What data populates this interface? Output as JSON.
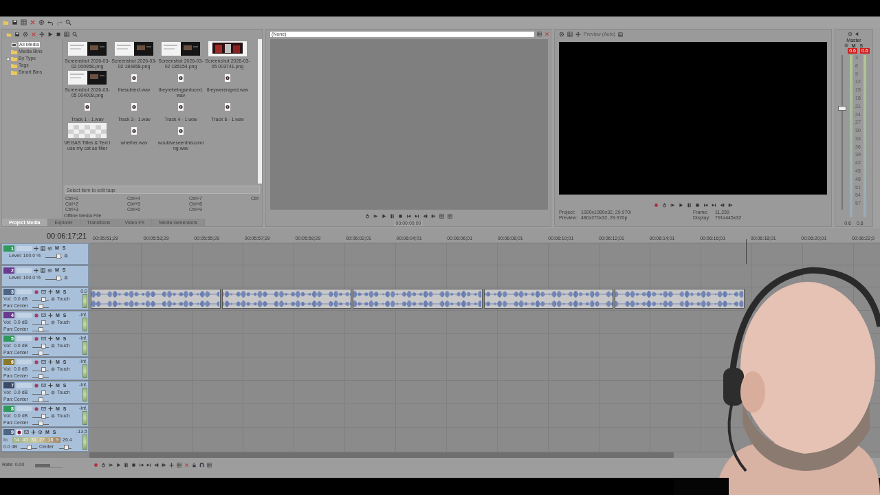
{
  "explorer": {
    "tree": [
      {
        "label": "All Media",
        "kind": "all",
        "selected": true
      },
      {
        "label": "Media Bins",
        "kind": "folder",
        "selected": false
      },
      {
        "label": "By Type",
        "kind": "collapsed_folder",
        "selected": false
      },
      {
        "label": "Tags",
        "kind": "folder",
        "selected": false
      },
      {
        "label": "Smart Bins",
        "kind": "folder",
        "selected": false
      }
    ],
    "media": [
      {
        "name": "Screenshot 2026-03-02 000958.png"
      },
      {
        "name": "Screenshot 2026-03-02 184858.png"
      },
      {
        "name": "Screenshot 2026-03-02 185154.png"
      },
      {
        "name": "Screenshot 2026-03-05 003741.png"
      },
      {
        "name": "Screenshot 2026-03-05 004008.png"
      },
      {
        "name": "thesubtext.wav",
        "kind": "audio"
      },
      {
        "name": "theyrebeingseduced.wav",
        "kind": "audio"
      },
      {
        "name": "theywereraped.wav",
        "kind": "audio"
      },
      {
        "name": "Track 1 - 1.wav",
        "kind": "audio"
      },
      {
        "name": "Track 3 - 1.wav",
        "kind": "audio"
      },
      {
        "name": "Track 4 - 1.wav",
        "kind": "audio"
      },
      {
        "name": "Track 6 - 1.wav",
        "kind": "audio"
      },
      {
        "name": "VEGAS Titles & Text I use my cat as filler",
        "kind": "title"
      },
      {
        "name": "whether.wav",
        "kind": "audio"
      },
      {
        "name": "wouldveseenthiscoming.wav",
        "kind": "audio"
      }
    ],
    "tag_placeholder": "Select item to edit tags",
    "shortcuts": [
      "Ctrl+1",
      "Ctrl+2",
      "Ctrl+3",
      "Ctrl+4",
      "Ctrl+5",
      "Ctrl+6",
      "Ctrl+7",
      "Ctrl+8",
      "Ctrl+9",
      "Ctrl"
    ],
    "status": "Offline Media File",
    "tabs": [
      {
        "label": "Project Media",
        "selected": true
      },
      {
        "label": "Explorer",
        "selected": false
      },
      {
        "label": "Transitions",
        "selected": false
      },
      {
        "label": "Video FX",
        "selected": false
      },
      {
        "label": "Media Generators",
        "selected": false
      }
    ]
  },
  "trimmer": {
    "source": "(None)",
    "time": "00:00:00;00"
  },
  "preview": {
    "mode": "Preview (Auto)",
    "info": [
      {
        "label": "Project:",
        "value": "1920x1080x32, 29.970i"
      },
      {
        "label": "Preview:",
        "value": "480x270x32, 29.970p"
      },
      {
        "label": "Frame:",
        "value": "11,239"
      },
      {
        "label": "Display:",
        "value": "791x445x32"
      }
    ]
  },
  "master": {
    "label": "Master",
    "mute": "M",
    "solo": "S",
    "peaks": [
      "0.6",
      "0.6"
    ],
    "scale": [
      "3",
      "6",
      "9",
      "12",
      "15",
      "18",
      "21",
      "24",
      "27",
      "30",
      "33",
      "36",
      "39",
      "42",
      "45",
      "48",
      "51",
      "54",
      "57"
    ],
    "footer": [
      "0.6",
      "0.6"
    ],
    "fader": {
      "level": 0.67
    }
  },
  "timeline": {
    "time": "00:06:17;21",
    "playhead": {
      "level": 0.83
    },
    "ruler": [
      "00:05:51;29",
      "00:05:53;29",
      "00:05:55;29",
      "00:05:57;29",
      "00:05:59;29",
      "00:06:02;01",
      "00:06:04;01",
      "00:06:06;01",
      "00:06:08;01",
      "00:06:10;01",
      "00:06:12;01",
      "00:06:14;01",
      "00:06:16;01",
      "00:06:18;01",
      "00:06:20;01",
      "00:06:22;0"
    ],
    "tracks": [
      {
        "kind": "video",
        "number": "1",
        "color": "#2f9a5c",
        "mute": "M",
        "solo": "S",
        "opacity": {
          "text": "Level: 100.0 %",
          "level": 0.95
        }
      },
      {
        "kind": "video",
        "number": "2",
        "color": "#6a3a8c",
        "mute": "M",
        "solo": "S",
        "opacity": {
          "text": "Level: 100.0 %",
          "level": 0.95
        }
      },
      {
        "kind": "audio",
        "number": "3",
        "color": "#4f6584",
        "armed": false,
        "mute": "M",
        "solo": "S",
        "peak": "0.0",
        "mode": "Touch",
        "vol_label": "Vol:",
        "volume": {
          "text": "0.0 dB",
          "level": 0.75
        },
        "pan_label": "Pan:",
        "pan": {
          "text": "Center",
          "level": 0.5
        },
        "events": [
          {
            "kind": "audio"
          },
          {
            "kind": "audio"
          },
          {
            "kind": "audio"
          },
          {
            "kind": "audio"
          },
          {
            "kind": "audio"
          }
        ]
      },
      {
        "kind": "audio",
        "number": "4",
        "color": "#6a3a8c",
        "armed": false,
        "mute": "M",
        "solo": "S",
        "peak": "-Inf.",
        "mode": "Touch",
        "vol_label": "Vol:",
        "volume": {
          "text": "0.0 dB",
          "level": 0.75
        },
        "pan_label": "Pan:",
        "pan": {
          "text": "Center",
          "level": 0.5
        }
      },
      {
        "kind": "audio",
        "number": "5",
        "color": "#2f9a5c",
        "armed": false,
        "mute": "M",
        "solo": "S",
        "peak": "-Inf.",
        "mode": "Touch",
        "vol_label": "Vol:",
        "volume": {
          "text": "0.0 dB",
          "level": 0.75
        },
        "pan_label": "Pan:",
        "pan": {
          "text": "Center",
          "level": 0.5
        }
      },
      {
        "kind": "audio",
        "number": "6",
        "color": "#8a7a2a",
        "armed": false,
        "mute": "M",
        "solo": "S",
        "peak": "-Inf.",
        "mode": "Touch",
        "vol_label": "Vol:",
        "volume": {
          "text": "0.0 dB",
          "level": 0.75
        },
        "pan_label": "Pan:",
        "pan": {
          "text": "Center",
          "level": 0.5
        }
      },
      {
        "kind": "audio",
        "number": "7",
        "color": "#3a4a66",
        "armed": false,
        "mute": "M",
        "solo": "S",
        "peak": "-Inf.",
        "mode": "Touch",
        "vol_label": "Vol:",
        "volume": {
          "text": "0.0 dB",
          "level": 0.75
        },
        "pan_label": "Pan:",
        "pan": {
          "text": "Center",
          "level": 0.5
        }
      },
      {
        "kind": "audio",
        "number": "8",
        "color": "#2f9a5c",
        "armed": false,
        "mute": "M",
        "solo": "S",
        "peak": "-Inf.",
        "mode": "Touch",
        "vol_label": "Vol:",
        "volume": {
          "text": "0.0 dB",
          "level": 0.75
        },
        "pan_label": "Pan:",
        "pan": {
          "text": "Center",
          "level": 0.5
        }
      },
      {
        "kind": "input",
        "number": "9",
        "color": "#4f6584",
        "armed": true,
        "mute": "M",
        "solo": "S",
        "peak": "-13.5",
        "in_label": "In",
        "in_scale": [
          "54",
          "45",
          "36",
          "27",
          "18",
          "9"
        ],
        "in_reading": "26.4",
        "volume": {
          "text": "0.0 dB",
          "level": 0.5
        },
        "pan": {
          "text": "Center",
          "level": 0.6
        }
      }
    ],
    "rate": "Rate: 0.00",
    "rate_slider": {
      "level": 0.55
    }
  }
}
